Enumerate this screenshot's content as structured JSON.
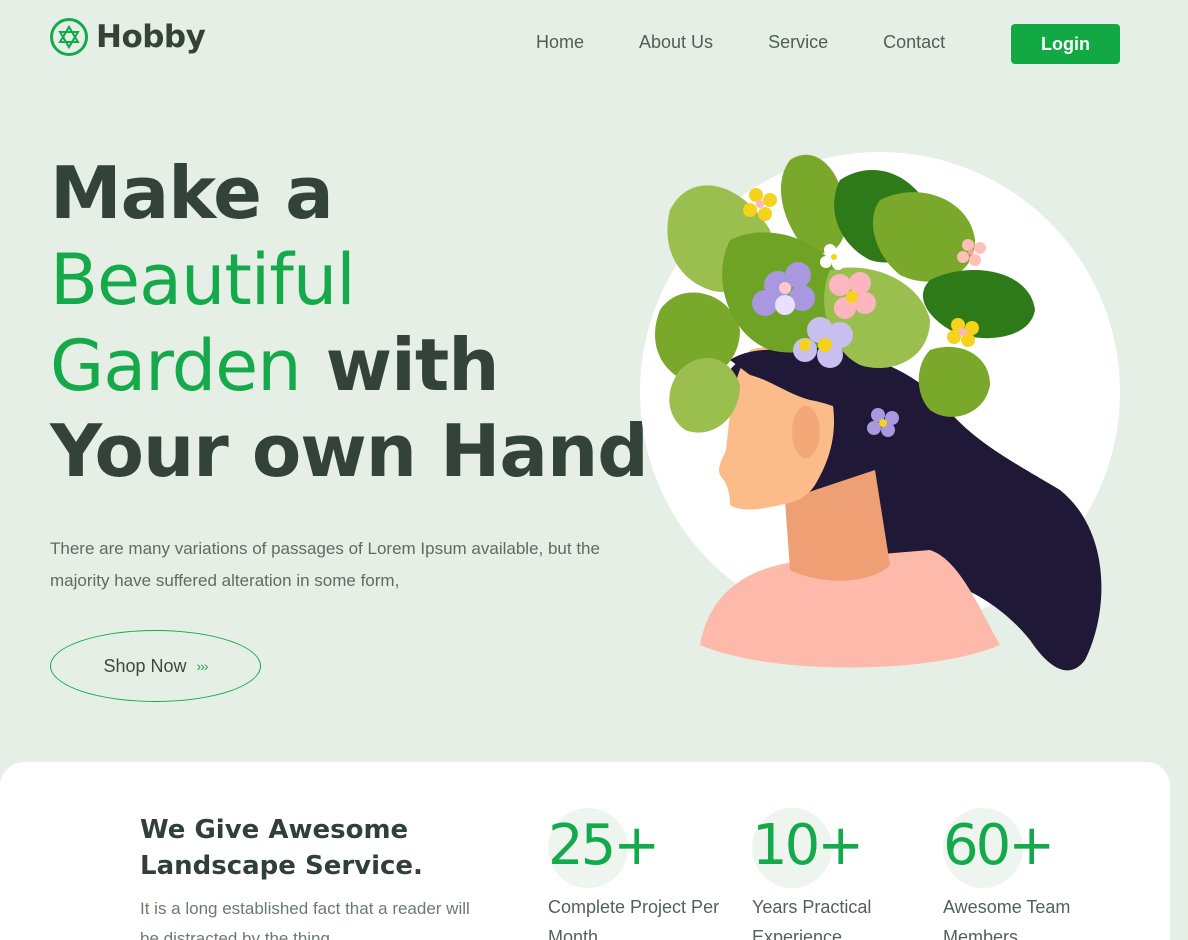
{
  "brand": {
    "name": "Hobby",
    "accent": "#14a94a"
  },
  "nav": {
    "items": [
      "Home",
      "About Us",
      "Service",
      "Contact"
    ],
    "login_label": "Login"
  },
  "hero": {
    "line1": "Make a",
    "line2": "Beautiful",
    "line3_light": "Garden",
    "line3_bold": "with",
    "line4": "Your own Hand",
    "description": "There are many variations of passages of Lorem Ipsum available, but the majority have suffered alteration in some form,",
    "cta_label": "Shop Now",
    "cta_arrows": "›››"
  },
  "services": {
    "title": "We Give Awesome Landscape Service.",
    "text": "It is a long established fact that a reader will be distracted by the thing",
    "stats": [
      {
        "number": "25+",
        "label": "Complete Project Per Month"
      },
      {
        "number": "10+",
        "label": "Years Practical Experience"
      },
      {
        "number": "60+",
        "label": "Awesome Team Members"
      }
    ]
  },
  "illustration": {
    "icon": "woman-with-plants-illustration"
  }
}
